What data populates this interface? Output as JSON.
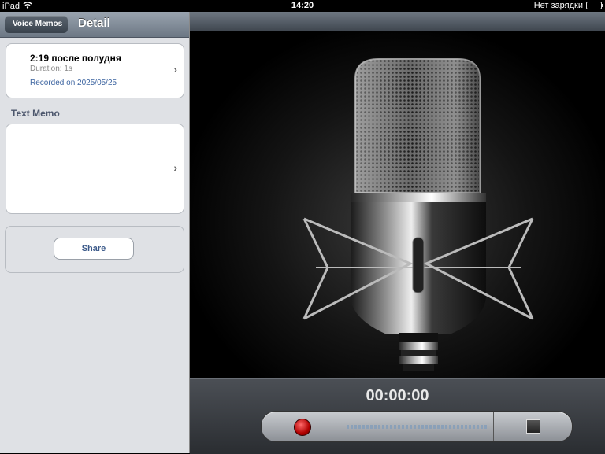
{
  "status": {
    "device": "iPad",
    "time": "14:20",
    "battery_text": "Нет зарядки"
  },
  "nav": {
    "back_label": "Voice Memos",
    "title": "Detail"
  },
  "memo": {
    "time": "2:19 после полудня",
    "duration": "Duration:  1s",
    "recorded": "Recorded on 2025/05/25"
  },
  "text_memo": {
    "section_label": "Text Memo"
  },
  "share": {
    "label": "Share"
  },
  "recorder": {
    "timer": "00:00:00"
  },
  "icons": [
    "wifi-icon",
    "battery-icon",
    "chevron-right-icon",
    "microphone-image",
    "record-icon",
    "stop-icon",
    "level-meter"
  ]
}
